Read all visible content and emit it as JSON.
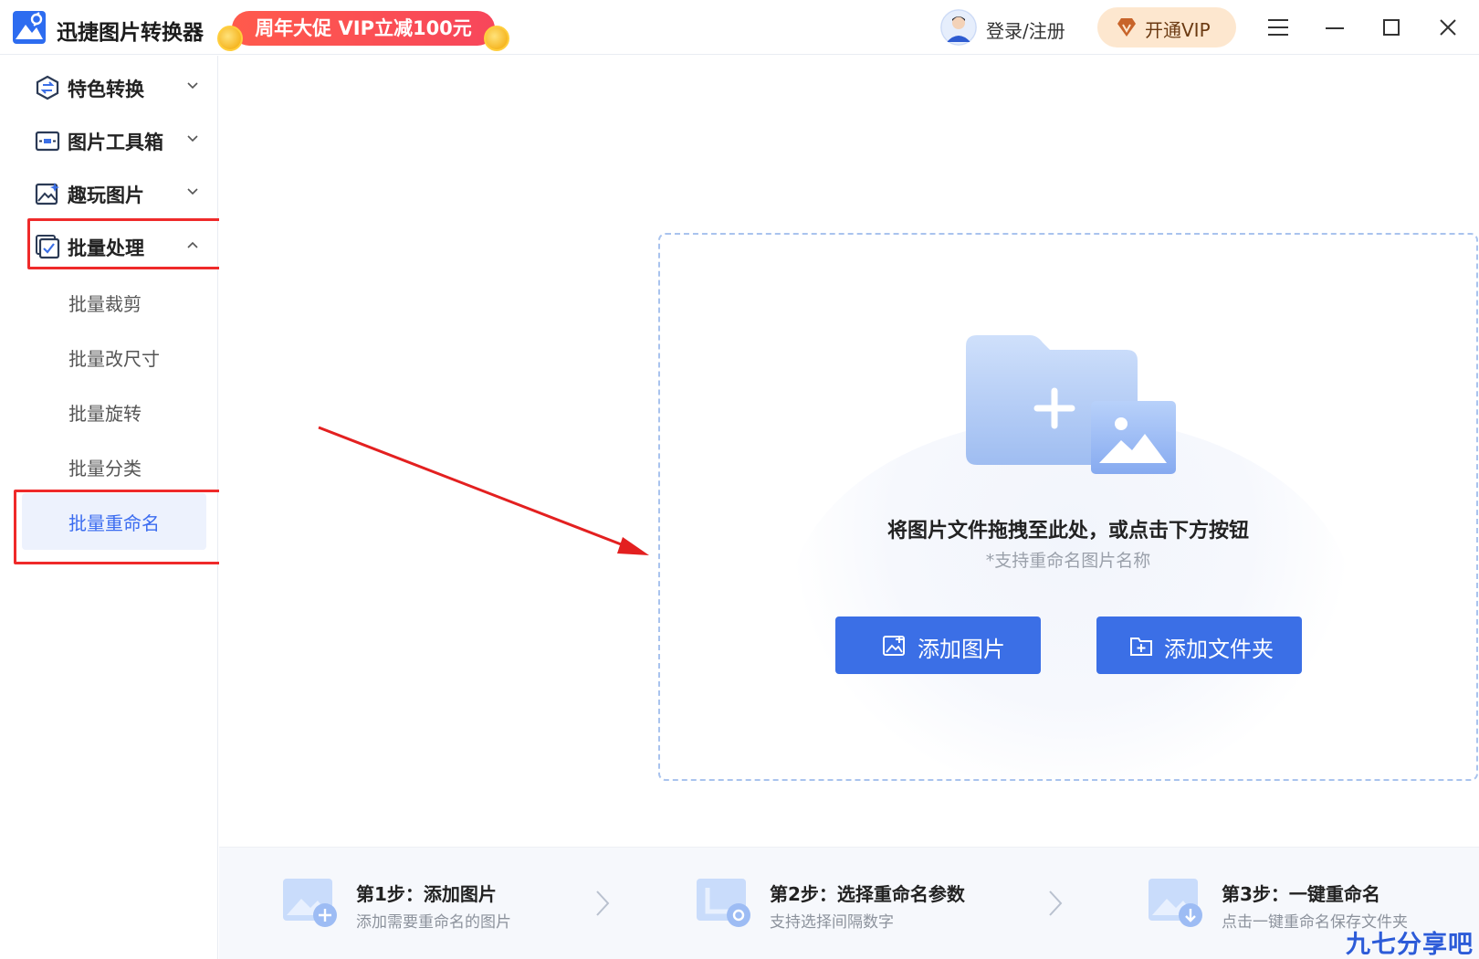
{
  "titlebar": {
    "app_title": "迅捷图片转换器",
    "promo_text": "周年大促 VIP立减100元",
    "login_text": "登录/注册",
    "vip_label": "开通VIP"
  },
  "sidebar": {
    "sections": [
      {
        "label": "特色转换",
        "icon": "hexagon-convert-icon",
        "state": "collapsed"
      },
      {
        "label": "图片工具箱",
        "icon": "toolbox-icon",
        "state": "collapsed"
      },
      {
        "label": "趣玩图片",
        "icon": "image-sparkle-icon",
        "state": "collapsed"
      },
      {
        "label": "批量处理",
        "icon": "batch-check-icon",
        "state": "expanded"
      }
    ],
    "batch_items": [
      {
        "label": "批量裁剪"
      },
      {
        "label": "批量改尺寸"
      },
      {
        "label": "批量旋转"
      },
      {
        "label": "批量分类"
      },
      {
        "label": "批量重命名",
        "active": true
      }
    ]
  },
  "dropzone": {
    "title": "将图片文件拖拽至此处，或点击下方按钮",
    "subtitle": "*支持重命名图片名称",
    "add_image_label": "添加图片",
    "add_folder_label": "添加文件夹"
  },
  "steps": [
    {
      "title": "第1步：添加图片",
      "desc": "添加需要重命名的图片"
    },
    {
      "title": "第2步：选择重命名参数",
      "desc": "支持选择间隔数字"
    },
    {
      "title": "第3步：一键重命名",
      "desc": "点击一键重命名保存文件夹"
    }
  ],
  "watermark": "九七分享吧",
  "colors": {
    "primary": "#3b6fe6",
    "highlight_box": "#ef2a2a",
    "active_item_bg": "#edf2fd",
    "promo": "#f7465b",
    "vip_bg": "#fde7cf"
  }
}
